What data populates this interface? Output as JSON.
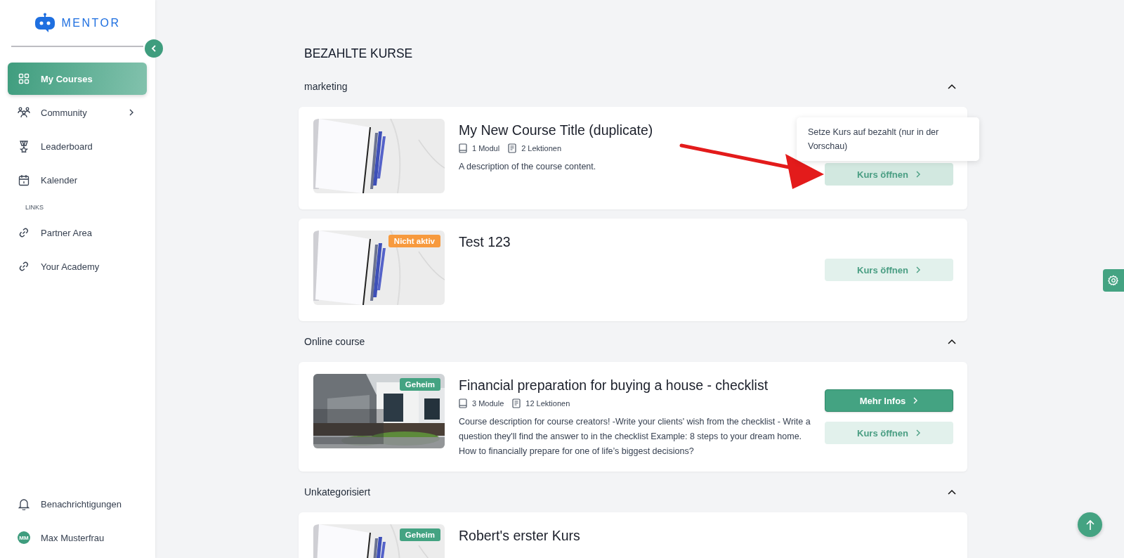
{
  "sidebar": {
    "logo": "MENTOR",
    "nav": [
      {
        "label": "My Courses",
        "selected": true,
        "submenu": false
      },
      {
        "label": "Community",
        "selected": false,
        "submenu": true
      },
      {
        "label": "Leaderboard",
        "selected": false,
        "submenu": false
      },
      {
        "label": "Kalender",
        "selected": false,
        "submenu": false
      }
    ],
    "links_heading": "LINKS",
    "links": [
      {
        "label": "Partner Area"
      },
      {
        "label": "Your Academy"
      }
    ],
    "notifications": "Benachrichtigungen",
    "user": {
      "initials": "MM",
      "name": "Max Musterfrau"
    }
  },
  "main": {
    "heading": "BEZAHLTE KURSE",
    "sections": [
      {
        "title": "marketing",
        "expanded": true,
        "courses": [
          {
            "title": "My New Course Title (duplicate)",
            "meta": {
              "modules": "1 Modul",
              "lessons": "2 Lektionen"
            },
            "description": "A description of the course content.",
            "buttons": [
              {
                "label": "Kurs öffnen",
                "kind": "secondary",
                "hovered": true,
                "tooltip": "Setze Kurs auf bezahlt (nur in der Vorschau)"
              }
            ]
          },
          {
            "title": "Test 123",
            "badge": {
              "text": "Nicht aktiv",
              "color": "#f79a3e"
            },
            "buttons": [
              {
                "label": "Kurs öffnen",
                "kind": "secondary",
                "hovered": false
              }
            ]
          }
        ]
      },
      {
        "title": "Online course",
        "expanded": true,
        "courses": [
          {
            "title": "Financial preparation for buying a house - checklist",
            "badge": {
              "text": "Geheim",
              "color": "#44a382"
            },
            "meta": {
              "modules": "3 Module",
              "lessons": "12 Lektionen"
            },
            "description": "Course description for course creators! -Write your clients' wish from the checklist - Write a question they'll find the answer to in the checklist Example: 8 steps to your dream home. How to financially prepare for one of life’s biggest decisions?",
            "buttons": [
              {
                "label": "Mehr Infos",
                "kind": "primary",
                "hovered": false
              },
              {
                "label": "Kurs öffnen",
                "kind": "secondary",
                "hovered": false
              }
            ]
          }
        ]
      },
      {
        "title": "Unkategorisiert",
        "expanded": true,
        "courses": [
          {
            "title": "Robert's erster Kurs",
            "badge": {
              "text": "Geheim",
              "color": "#44a382"
            }
          }
        ]
      }
    ]
  },
  "annotation": {
    "kind": "arrow"
  }
}
